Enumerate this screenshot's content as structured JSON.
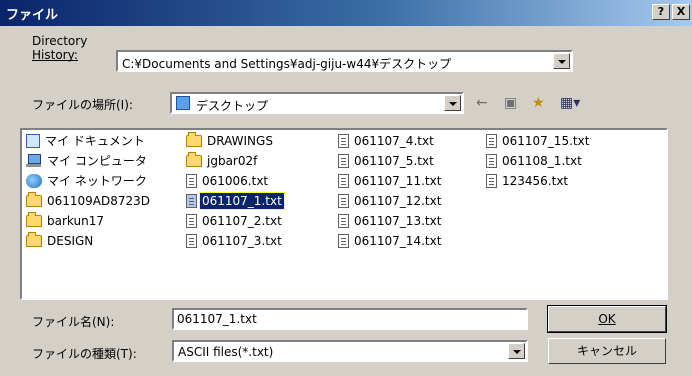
{
  "window": {
    "title": "ファイル",
    "help_button": "?",
    "close_button": "X"
  },
  "directory_history": {
    "label_line1": "Directory",
    "label_line2": "History:",
    "value": "C:¥Documents and Settings¥adj-giju-w44¥デスクトップ"
  },
  "look_in": {
    "label": "ファイルの場所(I):",
    "value": "デスクトップ",
    "toolbar": {
      "back_icon": "back-arrow-icon",
      "up_folder_icon": "up-folder-icon",
      "new_folder_icon": "new-folder-icon",
      "view_menu_icon": "view-menu-icon"
    }
  },
  "files": {
    "col1": [
      {
        "name": "マイ ドキュメント",
        "icon": "my-documents-icon"
      },
      {
        "name": "マイ コンピュータ",
        "icon": "my-computer-icon"
      },
      {
        "name": "マイ ネットワーク",
        "icon": "my-network-icon"
      },
      {
        "name": "061109AD8723D",
        "icon": "folder-icon"
      },
      {
        "name": "barkun17",
        "icon": "folder-icon"
      },
      {
        "name": "DESIGN",
        "icon": "folder-icon"
      }
    ],
    "col2": [
      {
        "name": "DRAWINGS",
        "icon": "folder-icon"
      },
      {
        "name": "jgbar02f",
        "icon": "folder-icon"
      },
      {
        "name": "061006.txt",
        "icon": "text-file-icon"
      },
      {
        "name": "061107_1.txt",
        "icon": "text-file-icon",
        "selected": true
      },
      {
        "name": "061107_2.txt",
        "icon": "text-file-icon"
      },
      {
        "name": "061107_3.txt",
        "icon": "text-file-icon"
      }
    ],
    "col3": [
      {
        "name": "061107_4.txt",
        "icon": "text-file-icon"
      },
      {
        "name": "061107_5.txt",
        "icon": "text-file-icon"
      },
      {
        "name": "061107_11.txt",
        "icon": "text-file-icon"
      },
      {
        "name": "061107_12.txt",
        "icon": "text-file-icon"
      },
      {
        "name": "061107_13.txt",
        "icon": "text-file-icon"
      },
      {
        "name": "061107_14.txt",
        "icon": "text-file-icon"
      }
    ],
    "col4": [
      {
        "name": "061107_15.txt",
        "icon": "text-file-icon"
      },
      {
        "name": "061108_1.txt",
        "icon": "text-file-icon"
      },
      {
        "name": "123456.txt",
        "icon": "text-file-icon"
      }
    ]
  },
  "file_name": {
    "label": "ファイル名(N):",
    "value": "061107_1.txt"
  },
  "file_type": {
    "label": "ファイルの種類(T):",
    "value": "ASCII files(*.txt)"
  },
  "buttons": {
    "ok": "OK",
    "cancel": "キャンセル"
  }
}
